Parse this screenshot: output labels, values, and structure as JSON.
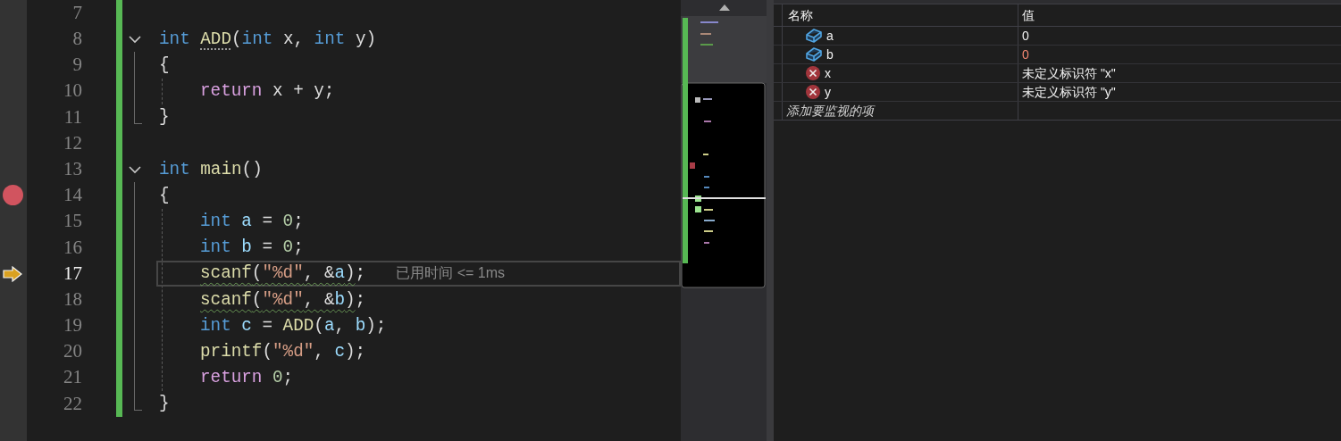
{
  "editor": {
    "lines": [
      {
        "number": "7"
      },
      {
        "number": "8",
        "collapsible": true,
        "tokens": [
          {
            "text": "int ",
            "kind": "keyword"
          },
          {
            "text": "ADD",
            "kind": "function",
            "dots": true
          },
          {
            "text": "(",
            "kind": "plain"
          },
          {
            "text": "int ",
            "kind": "keyword"
          },
          {
            "text": "x, ",
            "kind": "plain"
          },
          {
            "text": "int ",
            "kind": "keyword"
          },
          {
            "text": "y)",
            "kind": "plain"
          }
        ]
      },
      {
        "number": "9",
        "in_block": true,
        "tokens": [
          {
            "text": "{",
            "kind": "plain"
          }
        ]
      },
      {
        "number": "10",
        "in_block": true,
        "indented": true,
        "tokens": [
          {
            "text": "return ",
            "kind": "control"
          },
          {
            "text": "x + y;",
            "kind": "plain"
          }
        ]
      },
      {
        "number": "11",
        "in_block": true,
        "block_end": true,
        "tokens": [
          {
            "text": "}",
            "kind": "plain"
          }
        ]
      },
      {
        "number": "12"
      },
      {
        "number": "13",
        "collapsible": true,
        "tokens": [
          {
            "text": "int ",
            "kind": "keyword"
          },
          {
            "text": "main",
            "kind": "function"
          },
          {
            "text": "()",
            "kind": "plain"
          }
        ]
      },
      {
        "number": "14",
        "in_block": true,
        "breakpoint": true,
        "tokens": [
          {
            "text": "{",
            "kind": "plain"
          }
        ]
      },
      {
        "number": "15",
        "in_block": true,
        "indented": true,
        "tokens": [
          {
            "text": "int ",
            "kind": "keyword"
          },
          {
            "text": "a",
            "kind": "variable"
          },
          {
            "text": " = ",
            "kind": "plain"
          },
          {
            "text": "0",
            "kind": "number"
          },
          {
            "text": ";",
            "kind": "plain"
          }
        ]
      },
      {
        "number": "16",
        "in_block": true,
        "indented": true,
        "tokens": [
          {
            "text": "int ",
            "kind": "keyword"
          },
          {
            "text": "b",
            "kind": "variable"
          },
          {
            "text": " = ",
            "kind": "plain"
          },
          {
            "text": "0",
            "kind": "number"
          },
          {
            "text": ";",
            "kind": "plain"
          }
        ]
      },
      {
        "number": "17",
        "in_block": true,
        "indented": true,
        "current": true,
        "hint": "已用时间 <= 1ms",
        "tokens": [
          {
            "text": "scanf",
            "kind": "function",
            "squiggle": true
          },
          {
            "text": "(",
            "kind": "plain",
            "squiggle": true
          },
          {
            "text": "\"%d\"",
            "kind": "string",
            "squiggle": true
          },
          {
            "text": ", &",
            "kind": "plain",
            "squiggle": true
          },
          {
            "text": "a",
            "kind": "variable",
            "squiggle": true
          },
          {
            "text": ")",
            "kind": "plain",
            "squiggle": true
          },
          {
            "text": ";",
            "kind": "plain"
          }
        ]
      },
      {
        "number": "18",
        "in_block": true,
        "indented": true,
        "tokens": [
          {
            "text": "scanf",
            "kind": "function",
            "squiggle": true
          },
          {
            "text": "(",
            "kind": "plain",
            "squiggle": true
          },
          {
            "text": "\"%d\"",
            "kind": "string",
            "squiggle": true
          },
          {
            "text": ", &",
            "kind": "plain",
            "squiggle": true
          },
          {
            "text": "b",
            "kind": "variable",
            "squiggle": true
          },
          {
            "text": ")",
            "kind": "plain",
            "squiggle": true
          },
          {
            "text": ";",
            "kind": "plain"
          }
        ]
      },
      {
        "number": "19",
        "in_block": true,
        "indented": true,
        "tokens": [
          {
            "text": "int ",
            "kind": "keyword"
          },
          {
            "text": "c",
            "kind": "variable"
          },
          {
            "text": " = ",
            "kind": "plain"
          },
          {
            "text": "ADD",
            "kind": "function"
          },
          {
            "text": "(",
            "kind": "plain"
          },
          {
            "text": "a",
            "kind": "variable"
          },
          {
            "text": ", ",
            "kind": "plain"
          },
          {
            "text": "b",
            "kind": "variable"
          },
          {
            "text": ");",
            "kind": "plain"
          }
        ]
      },
      {
        "number": "20",
        "in_block": true,
        "indented": true,
        "tokens": [
          {
            "text": "printf",
            "kind": "function"
          },
          {
            "text": "(",
            "kind": "plain"
          },
          {
            "text": "\"%d\"",
            "kind": "string"
          },
          {
            "text": ", ",
            "kind": "plain"
          },
          {
            "text": "c",
            "kind": "variable"
          },
          {
            "text": ");",
            "kind": "plain"
          }
        ]
      },
      {
        "number": "21",
        "in_block": true,
        "indented": true,
        "tokens": [
          {
            "text": "return ",
            "kind": "control"
          },
          {
            "text": "0",
            "kind": "number"
          },
          {
            "text": ";",
            "kind": "plain"
          }
        ]
      },
      {
        "number": "22",
        "in_block": true,
        "block_end": true,
        "tokens": [
          {
            "text": "}",
            "kind": "plain"
          }
        ]
      }
    ]
  },
  "watch": {
    "columns": [
      "名称",
      "值"
    ],
    "rows": [
      {
        "kind": "variable",
        "name": "a",
        "value": "0",
        "changed": false
      },
      {
        "kind": "variable",
        "name": "b",
        "value": "0",
        "changed": true
      },
      {
        "kind": "error",
        "name": "x",
        "value": "未定义标识符 \"x\"",
        "changed": false
      },
      {
        "kind": "error",
        "name": "y",
        "value": "未定义标识符 \"y\"",
        "changed": false
      }
    ],
    "add_placeholder": "添加要监视的项"
  }
}
